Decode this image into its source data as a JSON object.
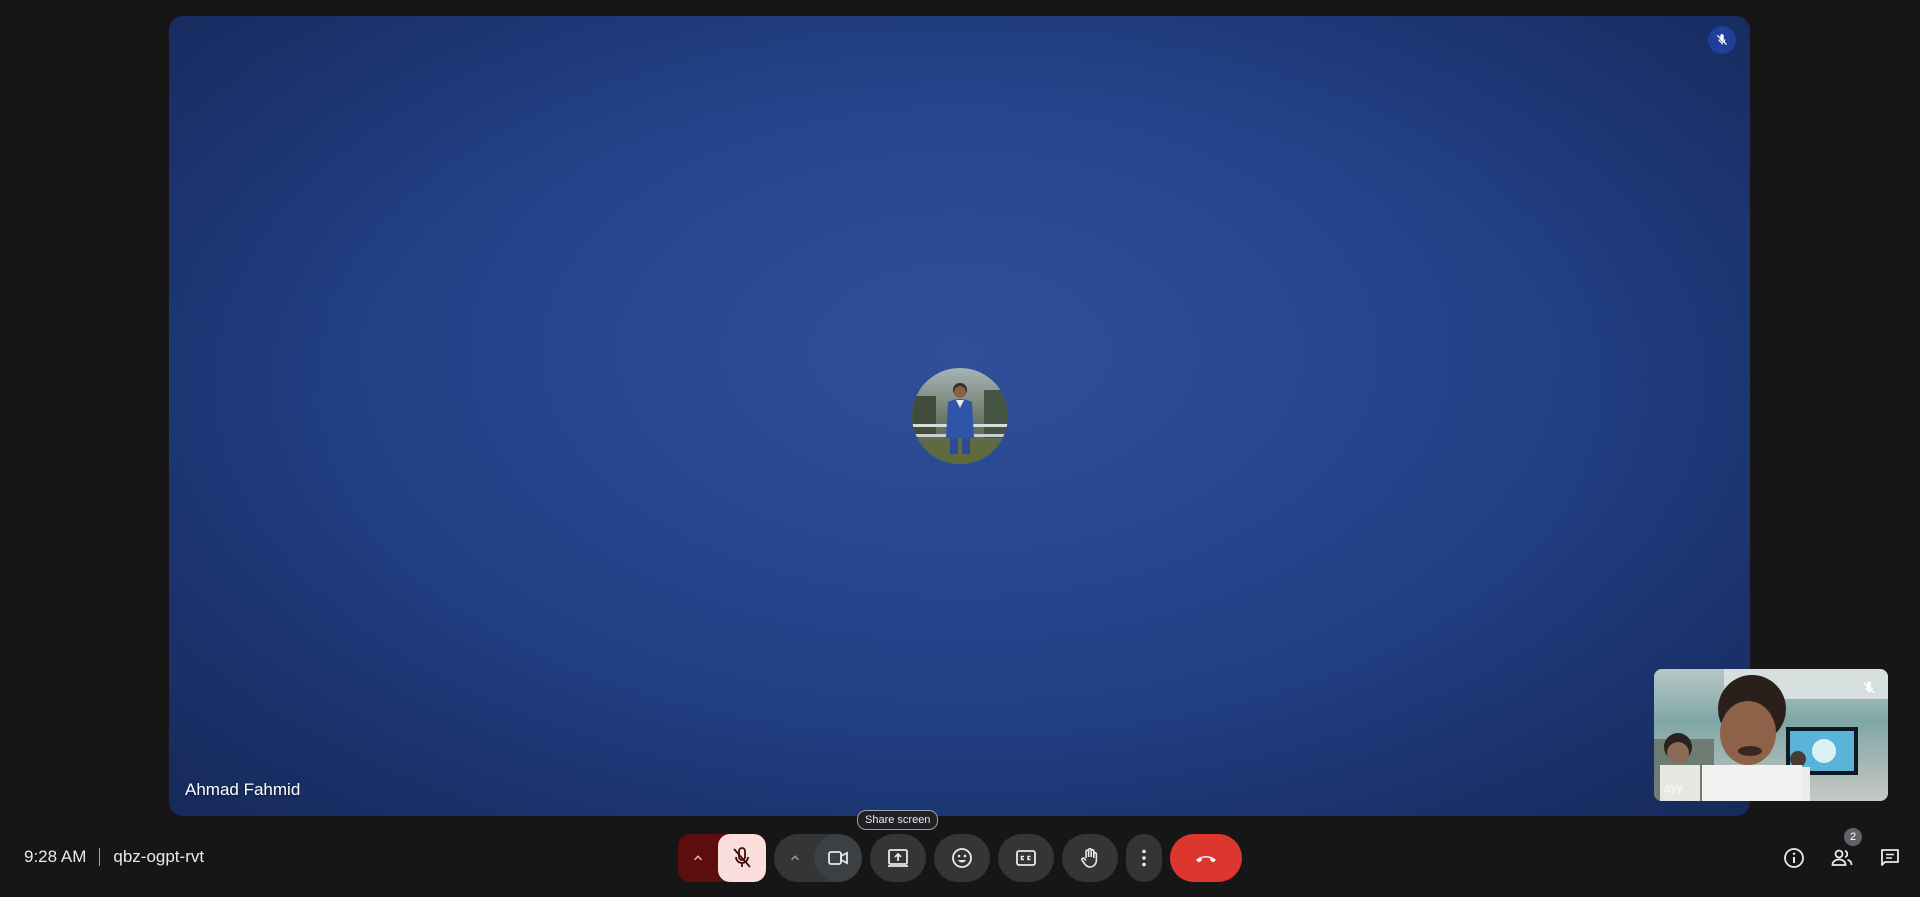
{
  "stage": {
    "participant_name": "Ahmad Fahmid",
    "participant_muted": true
  },
  "self_view": {
    "label": "ayy",
    "muted": true
  },
  "meeting": {
    "time": "9:28 AM",
    "code": "qbz-ogpt-rvt"
  },
  "controls": {
    "tooltip": "Share screen",
    "mic": {
      "state": "off"
    },
    "camera": {
      "state": "on"
    },
    "icons": {
      "mic": "mic-off-icon",
      "camera": "videocam-icon",
      "share": "present-to-all-icon",
      "emoji": "emoji-icon",
      "captions": "closed-captions-icon",
      "hand": "raise-hand-icon",
      "more": "more-vert-icon",
      "end": "call-end-icon"
    }
  },
  "right_tools": {
    "people_count": "2",
    "icons": {
      "info": "info-icon",
      "people": "people-icon",
      "chat": "chat-icon"
    }
  },
  "colors": {
    "background": "#161616",
    "stage_blue": "#284791",
    "end_call": "#dc362e",
    "mic_off_bg": "#f9dedc",
    "mic_group_bg": "#5c0d0d",
    "control_bg": "#333537"
  }
}
